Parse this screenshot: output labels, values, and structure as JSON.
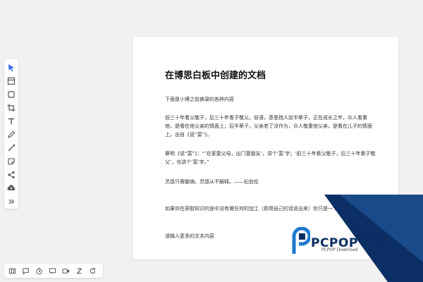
{
  "document": {
    "title": "在博思白板中创建的文档",
    "paragraphs": [
      "下面是小博之前搞录的各种内容",
      "前三十年看父敬子，后三十年看子敬父。俗语，意思指人前半辈子，正在成长之年，众人看重他，是看在他父亲的情面上；后半辈子，父亲老了没作为，众人敬重他父亲，是看在儿子的情面上。出自《说“富”》。",
      "蔡明《说“富”》：“‘在家靠父母，出门靠朋友’，讲个‘富’字；‘前三十年看父敬子，后三十年看子敬父’，也讲个‘富’字。”",
      "灵感只需敢嗨，灵感从不解释。——纪伯伦",
      "如果你在获取知识的途中没有做任何的加工（即用自己的话说出来）你只是一个知识的搬运工。",
      "请输入更多的文本内容"
    ]
  },
  "left_toolbar": {
    "tools": [
      {
        "name": "select-tool",
        "icon": "cursor-icon",
        "active": true
      },
      {
        "name": "frame-tool",
        "icon": "frame-icon"
      },
      {
        "name": "shape-tool",
        "icon": "square-icon"
      },
      {
        "name": "crop-tool",
        "icon": "crop-icon"
      },
      {
        "name": "text-tool",
        "icon": "text-icon"
      },
      {
        "name": "pen-tool",
        "icon": "pen-icon"
      },
      {
        "name": "line-tool",
        "icon": "line-icon"
      },
      {
        "name": "sticky-note-tool",
        "icon": "sticky-note-icon"
      },
      {
        "name": "mindmap-tool",
        "icon": "share-icon"
      },
      {
        "name": "upload-tool",
        "icon": "cloud-upload-icon"
      },
      {
        "name": "more-tool",
        "icon": "double-chevron-icon"
      }
    ]
  },
  "bottom_toolbar": {
    "tools": [
      {
        "name": "map-button",
        "icon": "map-icon"
      },
      {
        "name": "comment-button",
        "icon": "comment-icon"
      },
      {
        "name": "timer-button",
        "icon": "timer-icon"
      },
      {
        "name": "chat-button",
        "icon": "chat-icon"
      },
      {
        "name": "video-button",
        "icon": "video-icon"
      },
      {
        "name": "sleep-button",
        "icon": "z-icon"
      },
      {
        "name": "refresh-button",
        "icon": "refresh-icon"
      }
    ]
  },
  "watermark": {
    "name": "PCPOP下载",
    "sub": "PCPOP Download",
    "colors": {
      "navy": "#0b2f64",
      "blue": "#1f7ad1"
    }
  }
}
